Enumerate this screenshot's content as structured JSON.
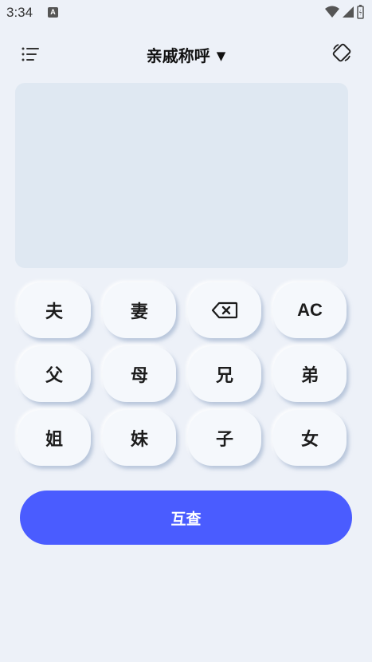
{
  "status_bar": {
    "time": "3:34",
    "notification_letter": "A",
    "icons": [
      "wifi-icon",
      "cell-signal-icon",
      "battery-icon"
    ]
  },
  "header": {
    "title": "亲戚称呼",
    "dropdown_indicator": "▼",
    "left_icon": "menu-list-icon",
    "right_icon": "screen-rotate-icon"
  },
  "display": {
    "text": ""
  },
  "keypad": {
    "keys": [
      "夫",
      "妻",
      "⌫",
      "AC",
      "父",
      "母",
      "兄",
      "弟",
      "姐",
      "妹",
      "子",
      "女"
    ],
    "backspace_icon": "backspace-icon"
  },
  "query_button": {
    "label": "互查"
  },
  "colors": {
    "background": "#edf1f8",
    "display_bg": "#dfe8f2",
    "key_bg": "#f5f8fc",
    "accent": "#4a5cff"
  }
}
